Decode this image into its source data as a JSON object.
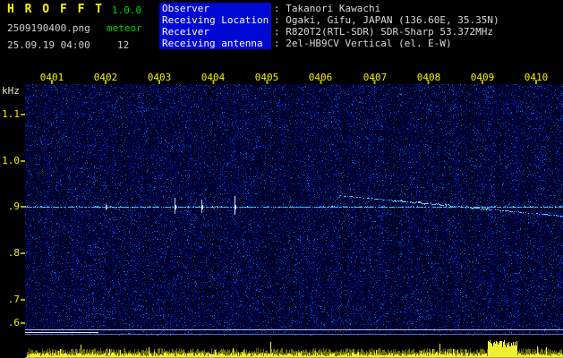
{
  "header": {
    "app_title": "H R O F F T",
    "version": "1.0.0",
    "filename": "2509190400.png",
    "mode": "meteor",
    "datetime": "25.09.19 04:00",
    "echo_count": "12",
    "info_rows": [
      {
        "label": "Observer",
        "value": ": Takanori Kawachi"
      },
      {
        "label": "Receiving Location",
        "value": ": Ogaki, Gifu, JAPAN (136.60E, 35.35N)"
      },
      {
        "label": "Receiver",
        "value": ": R820T2(RTL-SDR) SDR-Sharp 53.372MHz"
      },
      {
        "label": "Receiving antenna",
        "value": ": 2el-HB9CV Vertical (el. E-W)"
      }
    ]
  },
  "spectrogram": {
    "freq_axis_unit": "kHz",
    "freq_labels": [
      "1.1",
      "1.0",
      ".9",
      ".8",
      ".7",
      ".6"
    ],
    "time_labels": [
      "0401",
      "0402",
      "0403",
      "0404",
      "0405",
      "0406",
      "0407",
      "0408",
      "0409",
      "0410"
    ],
    "carrier_line_khz": 0.9
  },
  "colors": {
    "background": "#000000",
    "accent_yellow": "#f2f200",
    "accent_green": "#00d400",
    "label_blue": "#0008d4",
    "signal_cyan": "#00e8ff",
    "text_white": "#d8d8d8"
  }
}
